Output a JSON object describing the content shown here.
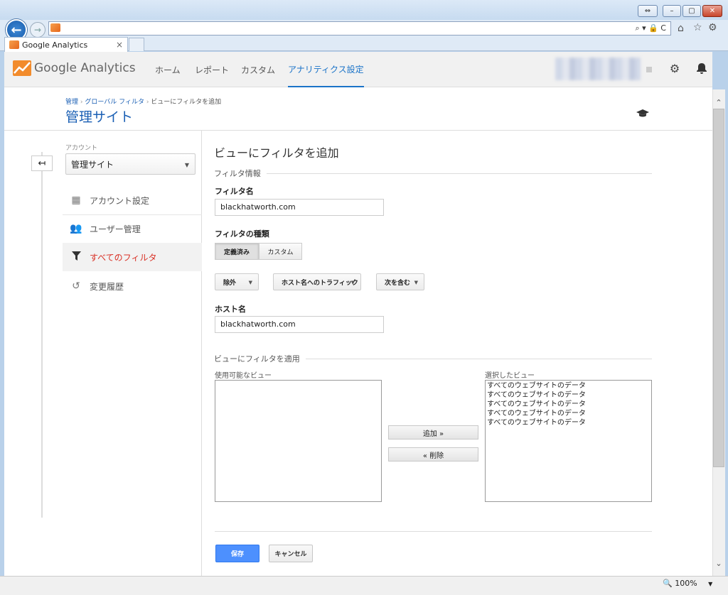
{
  "browser": {
    "tab_title": "Google Analytics",
    "tab_close": "×",
    "zoom": "100%",
    "search_glyph": "⌕ ▾ 🔒 C"
  },
  "header": {
    "logo_text": "Google Analytics",
    "nav": [
      {
        "label": "ホーム"
      },
      {
        "label": "レポート"
      },
      {
        "label": "カスタム"
      },
      {
        "label": "アナリティクス設定"
      }
    ]
  },
  "breadcrumb": {
    "items": [
      "管理",
      "グローバル フィルタ",
      "ビューにフィルタを追加"
    ]
  },
  "page_title": "管理サイト",
  "sidebar": {
    "account_label": "アカウント",
    "account_value": "管理サイト",
    "items": [
      {
        "label": "アカウント設定",
        "icon": "building-icon"
      },
      {
        "label": "ユーザー管理",
        "icon": "users-icon"
      },
      {
        "label": "すべてのフィルタ",
        "icon": "filter-icon"
      },
      {
        "label": "変更履歴",
        "icon": "history-icon"
      }
    ]
  },
  "form": {
    "heading": "ビューにフィルタを追加",
    "section_info": "フィルタ情報",
    "filter_name_label": "フィルタ名",
    "filter_name_value": "blackhatworth.com",
    "filter_type_label": "フィルタの種類",
    "type_predefined": "定義済み",
    "type_custom": "カスタム",
    "dd_exclude": "除外",
    "dd_traffic": "ホスト名へのトラフィック",
    "dd_contains": "次を含む",
    "hostname_label": "ホスト名",
    "hostname_value": "blackhatworth.com",
    "section_apply": "ビューにフィルタを適用",
    "available_label": "使用可能なビュー",
    "selected_label": "選択したビュー",
    "selected_views": [
      "すべてのウェブサイトのデータ",
      "すべてのウェブサイトのデータ",
      "すべてのウェブサイトのデータ",
      "すべてのウェブサイトのデータ",
      "すべてのウェブサイトのデータ"
    ],
    "add_button": "追加 »",
    "remove_button": "« 削除",
    "save_button": "保存",
    "cancel_button": "キャンセル"
  },
  "colors": {
    "accent": "#1a73c8",
    "active_menu": "#d93025",
    "save_button": "#4d90fe"
  }
}
